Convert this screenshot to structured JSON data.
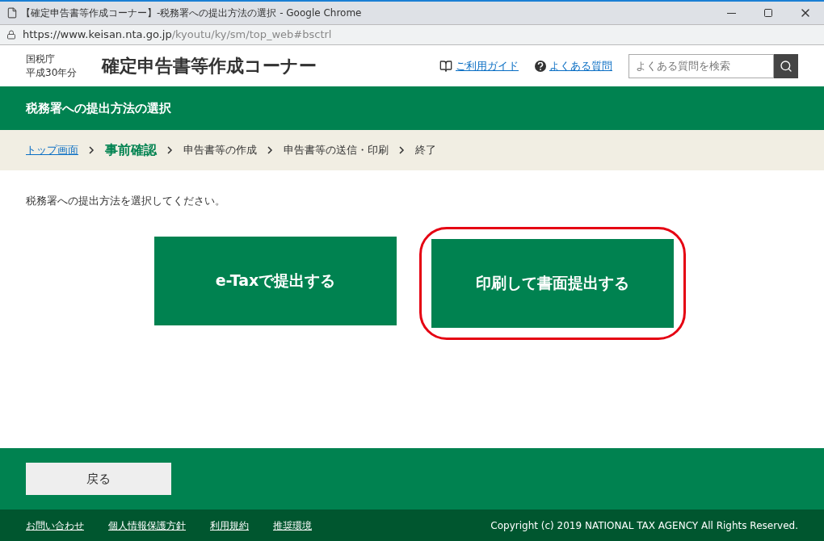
{
  "window": {
    "title": "【確定申告書等作成コーナー】-税務署への提出方法の選択 - Google Chrome",
    "url_host": "https://www.keisan.nta.go.jp",
    "url_path": "/kyoutu/ky/sm/top_web#bsctrl"
  },
  "header": {
    "agency": "国税庁",
    "year": "平成30年分",
    "title": "確定申告書等作成コーナー",
    "links": [
      {
        "kind": "guide",
        "label": "ご利用ガイド"
      },
      {
        "kind": "faq",
        "label": "よくある質問"
      }
    ],
    "search": {
      "placeholder": "よくある質問を検索"
    }
  },
  "page_title": "税務署への提出方法の選択",
  "breadcrumb": [
    {
      "kind": "link",
      "label": "トップ画面"
    },
    {
      "kind": "current",
      "label": "事前確認"
    },
    {
      "kind": "plain",
      "label": "申告書等の作成"
    },
    {
      "kind": "plain",
      "label": "申告書等の送信・印刷"
    },
    {
      "kind": "plain",
      "label": "終了"
    }
  ],
  "instruction": "税務署への提出方法を選択してください。",
  "options": [
    {
      "label": "e-Taxで提出する",
      "circled": false
    },
    {
      "label": "印刷して書面提出する",
      "circled": true
    }
  ],
  "back_button": "戻る",
  "footer": {
    "links": [
      "お問い合わせ",
      "個人情報保護方針",
      "利用規約",
      "推奨環境"
    ],
    "copyright": "Copyright (c) 2019 NATIONAL TAX AGENCY All Rights Reserved."
  }
}
